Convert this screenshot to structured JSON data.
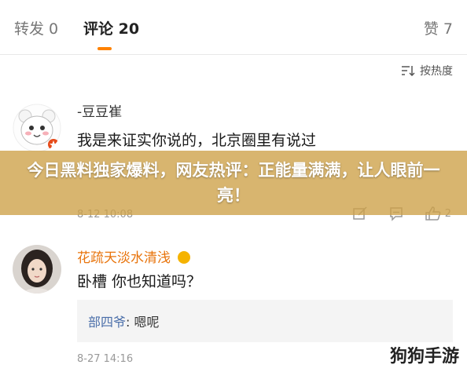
{
  "tabs": {
    "repost": "转发 0",
    "comment": "评论 20",
    "like": "赞 7"
  },
  "sort": {
    "label": "按热度",
    "icon": "sort-icon"
  },
  "comments": [
    {
      "nickname": "-豆豆崔",
      "content": "我是来证实你说的，北京圈里有说过",
      "time": "8-12 10:08",
      "likes": "2",
      "avatar_icon": "cartoon-bear-avatar"
    },
    {
      "nickname": "花疏天淡水清浅",
      "content": "卧槽 你也知道吗？",
      "reply": {
        "name": "部四爷",
        "text": ": 嗯呢"
      },
      "time": "8-27 14:16",
      "avatar_icon": "girl-photo-avatar"
    }
  ],
  "banner": {
    "text": "今日黑料独家爆料，网友热评：正能量满满，让人眼前一亮！"
  },
  "watermark": {
    "text": "狗狗手游"
  },
  "colors": {
    "accent": "#ff8200",
    "banner": "#cda046",
    "nickname_highlight": "#e8740c",
    "reply_name": "#4a6ea9"
  }
}
